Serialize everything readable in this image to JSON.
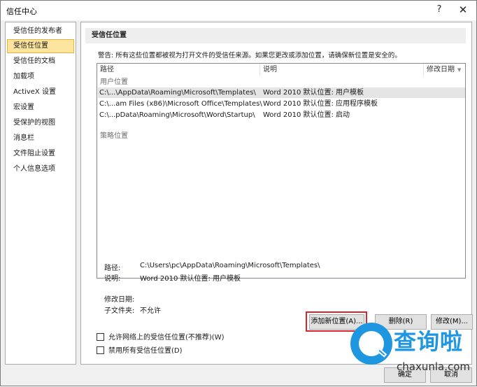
{
  "window": {
    "title": "信任中心",
    "help": "?",
    "close": "✕"
  },
  "sidebar": {
    "items": [
      {
        "label": "受信任的发布者",
        "selected": false
      },
      {
        "label": "受信任位置",
        "selected": true
      },
      {
        "label": "受信任的文档",
        "selected": false
      },
      {
        "label": "加载项",
        "selected": false
      },
      {
        "label": "ActiveX 设置",
        "selected": false
      },
      {
        "label": "宏设置",
        "selected": false
      },
      {
        "label": "受保护的视图",
        "selected": false
      },
      {
        "label": "消息栏",
        "selected": false
      },
      {
        "label": "文件阻止设置",
        "selected": false
      },
      {
        "label": "个人信息选项",
        "selected": false
      }
    ]
  },
  "main": {
    "section_title": "受信任位置",
    "warning": "警告: 所有这些位置都被视为打开文件的受信任来源。如果您更改或添加位置，请确保新位置是安全的。",
    "table": {
      "columns": [
        "路径",
        "说明",
        "修改日期"
      ],
      "sort_indicator": "▼",
      "user_group_label": "用户位置",
      "policy_group_label": "策略位置",
      "rows": [
        {
          "path": "C:\\...\\AppData\\Roaming\\Microsoft\\Templates\\",
          "description": "Word 2010 默认位置: 用户模板",
          "date": "",
          "selected": true
        },
        {
          "path": "C:\\...am Files (x86)\\Microsoft Office\\Templates\\",
          "description": "Word 2010 默认位置: 应用程序模板",
          "date": "",
          "selected": false
        },
        {
          "path": "C:\\...pData\\Roaming\\Microsoft\\Word\\Startup\\",
          "description": "Word 2010 默认位置: 启动",
          "date": "",
          "selected": false
        }
      ]
    },
    "details": {
      "path_label": "路径:",
      "path_value": "C:\\Users\\pc\\AppData\\Roaming\\Microsoft\\Templates\\",
      "desc_label": "说明:",
      "desc_value": "Word 2010 默认位置: 用户模板",
      "date_label": "修改日期:",
      "date_value": "",
      "subfolders_label": "子文件夹:",
      "subfolders_value": "不允许"
    },
    "buttons": {
      "add": "添加新位置(A)...",
      "remove": "删除(R)",
      "modify": "修改(M)..."
    },
    "checkboxes": [
      {
        "label": "允许网络上的受信任位置(不推荐)(W)",
        "checked": false
      },
      {
        "label": "禁用所有受信任位置(D)",
        "checked": false
      }
    ]
  },
  "footer": {
    "ok": "确定",
    "cancel": "取消"
  },
  "watermark": {
    "title": "查询啦",
    "url": "chaxunla.com"
  },
  "colors": {
    "selection": "#fde5a0",
    "highlight_box": "#d9252b",
    "watermark": "#1f96e0"
  }
}
